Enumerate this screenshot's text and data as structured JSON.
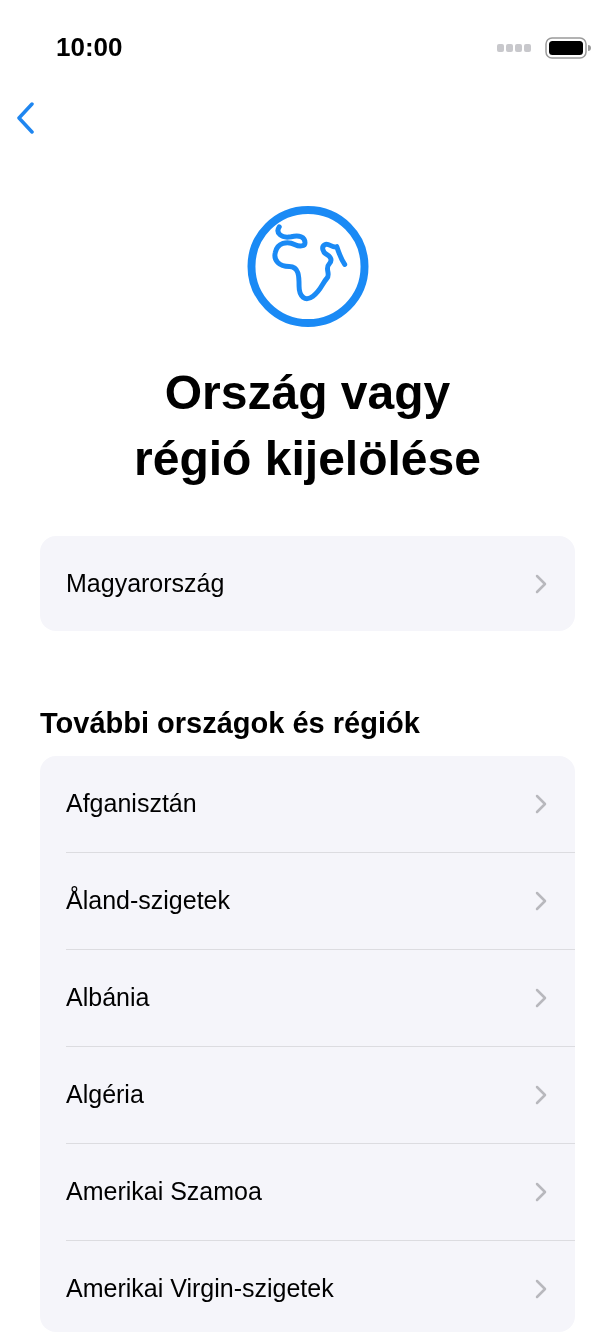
{
  "status_bar": {
    "time": "10:00"
  },
  "title": "Ország vagy régió kijelölése",
  "current_region": {
    "name": "Magyarország"
  },
  "section_title": "További országok és régiók",
  "countries": [
    {
      "name": "Afganisztán"
    },
    {
      "name": "Åland-szigetek"
    },
    {
      "name": "Albánia"
    },
    {
      "name": "Algéria"
    },
    {
      "name": "Amerikai Szamoa"
    },
    {
      "name": "Amerikai Virgin-szigetek"
    }
  ]
}
